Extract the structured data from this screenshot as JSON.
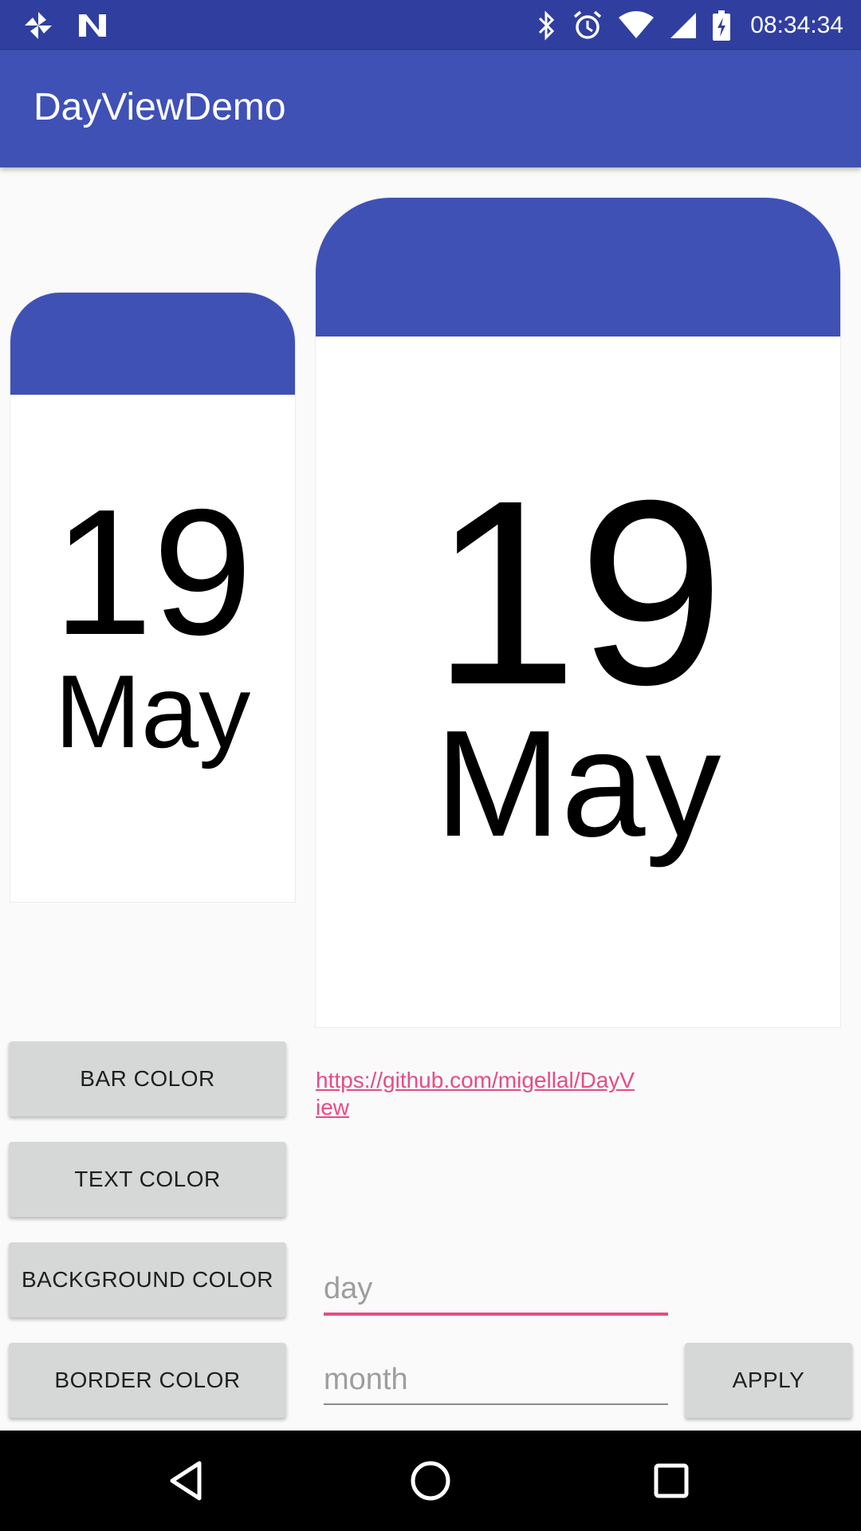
{
  "status_bar": {
    "time": "08:34:34",
    "left_icons": [
      "pinwheel-icon",
      "n-logo-icon"
    ],
    "right_icons": [
      "bluetooth-icon",
      "alarm-icon",
      "wifi-icon",
      "cell-signal-icon",
      "battery-icon"
    ]
  },
  "app_bar": {
    "title": "DayViewDemo"
  },
  "day_views": [
    {
      "day": "19",
      "month": "May"
    },
    {
      "day": "19",
      "month": "May"
    }
  ],
  "buttons": {
    "bar_color": "BAR COLOR",
    "text_color": "TEXT COLOR",
    "background_color": "BACKGROUND COLOR",
    "border_color": "BORDER COLOR",
    "apply": "APPLY"
  },
  "link": {
    "text": "https://github.com/migellal/DayView"
  },
  "inputs": {
    "day_placeholder": "day",
    "month_placeholder": "month"
  },
  "nav_bar": {
    "icons": [
      "back-icon",
      "home-icon",
      "recents-icon"
    ]
  },
  "colors": {
    "primary": "#3f51b5",
    "primary_dark": "#303f9f",
    "accent": "#e84b85",
    "button": "#d6d7d7"
  }
}
